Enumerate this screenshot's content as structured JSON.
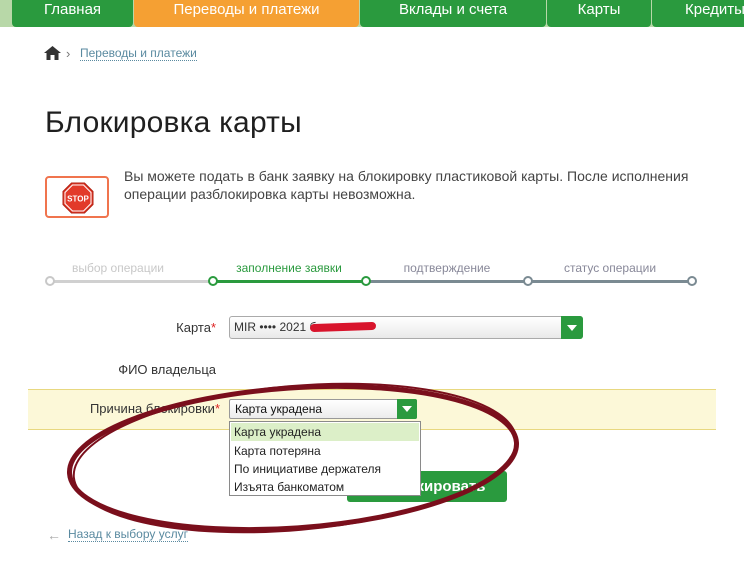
{
  "nav": {
    "items": [
      {
        "label": "Главная",
        "active": false
      },
      {
        "label": "Переводы и платежи",
        "active": true
      },
      {
        "label": "Вклады и счета",
        "active": false
      },
      {
        "label": "Карты",
        "active": false
      },
      {
        "label": "Кредиты",
        "active": false
      }
    ]
  },
  "breadcrumb": {
    "separator": "›",
    "link": "Переводы и платежи"
  },
  "page": {
    "title": "Блокировка карты",
    "info": "Вы можете подать в банк заявку на блокировку пластиковой карты. После исполнения операции разблокировка карты невозможна.",
    "stop_sign_text": "STOP"
  },
  "steps": [
    {
      "label": "выбор операции",
      "state": "done"
    },
    {
      "label": "заполнение заявки",
      "state": "current"
    },
    {
      "label": "подтверждение",
      "state": "pending"
    },
    {
      "label": "статус операции",
      "state": "pending"
    }
  ],
  "form": {
    "card": {
      "label": "Карта",
      "required_mark": "*",
      "value": "MIR   •••• 2021          б."
    },
    "owner": {
      "label": "ФИО владельца"
    },
    "reason": {
      "label": "Причина блокировки",
      "required_mark": "*",
      "value": "Карта украдена",
      "options": [
        "Карта украдена",
        "Карта потеряна",
        "По инициативе держателя",
        "Изъята банкоматом"
      ],
      "selected_index": 0
    },
    "submit_label": "кировать"
  },
  "back_link": {
    "arrow": "←",
    "label": "Назад к выбору услуг"
  },
  "colors": {
    "brand_green": "#2a9a3e",
    "active_orange": "#f5a033",
    "annotation": "#7a0f1c",
    "redaction": "#d8142c"
  }
}
